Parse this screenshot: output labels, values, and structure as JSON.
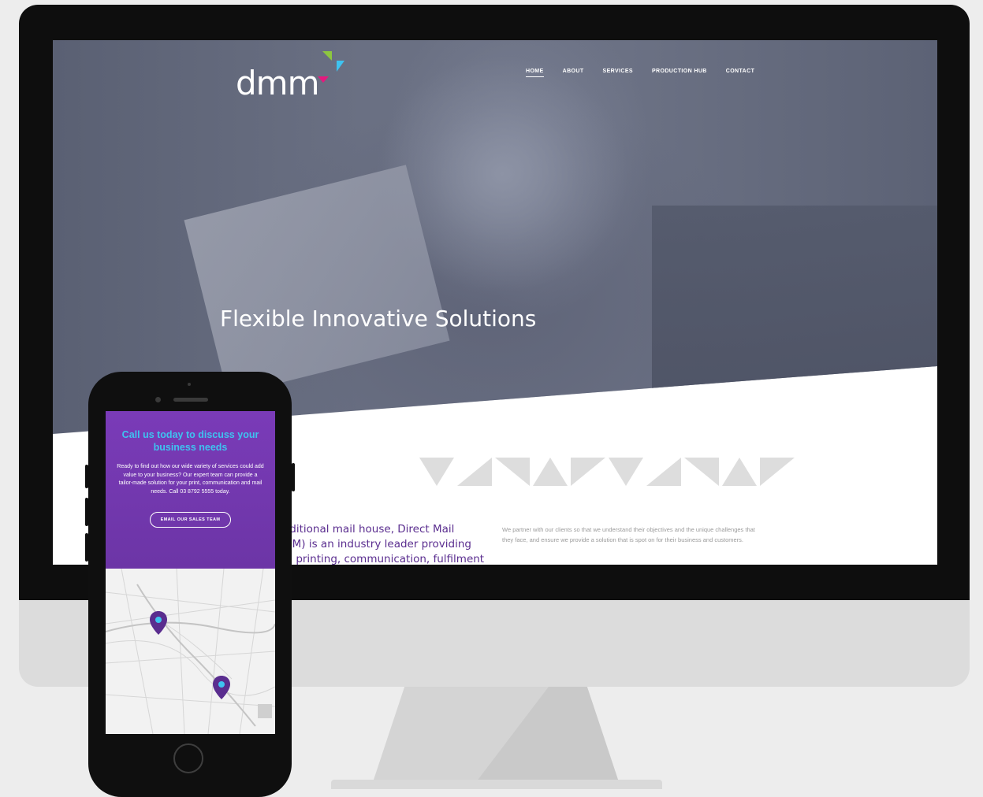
{
  "site": {
    "logo_text": "dmm",
    "nav": [
      {
        "label": "HOME",
        "active": true
      },
      {
        "label": "ABOUT",
        "active": false
      },
      {
        "label": "SERVICES",
        "active": false
      },
      {
        "label": "PRODUCTION HUB",
        "active": false
      },
      {
        "label": "CONTACT",
        "active": false
      }
    ],
    "hero_title": "Flexible Innovative Solutions",
    "intro_lines": [
      "aditional mail house, Direct Mail",
      "MM) is an industry leader providing",
      "al printing, communication, fulfilment"
    ],
    "partner_text": "We partner with our clients so that we understand their objectives and the unique challenges that they face, and ensure we provide a solution that is spot on for their business and customers."
  },
  "phone": {
    "cta_title": "Call us today to discuss your business needs",
    "cta_body": "Ready to find out how our wide variety of services could add value to your business? Our expert team can provide a tailor-made solution for your print, communication and mail needs. Call 03 8792 5555 today.",
    "cta_button": "EMAIL OUR SALES TEAM"
  },
  "colors": {
    "brand_purple": "#6c35a6",
    "brand_cyan": "#3ec3f0",
    "brand_green": "#8dc63f",
    "brand_magenta": "#e5197e",
    "hero_overlay": "#5f6478"
  },
  "icons": {
    "logo_mark": "dmm-triangle-mark",
    "map_pin": "map-pin-icon"
  }
}
